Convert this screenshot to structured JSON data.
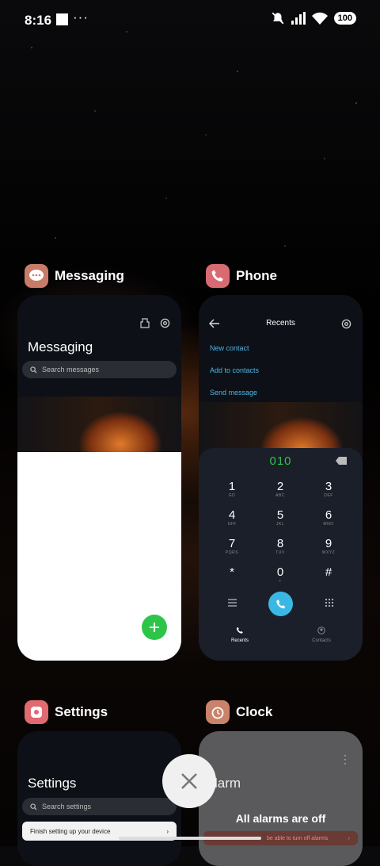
{
  "status": {
    "time": "8:16",
    "battery": "100"
  },
  "apps": {
    "messaging": {
      "name": "Messaging",
      "title": "Messaging",
      "search_placeholder": "Search messages"
    },
    "phone": {
      "name": "Phone",
      "header": "Recents",
      "links": [
        "New contact",
        "Add to contacts",
        "Send message"
      ],
      "dialed": "010",
      "keys": [
        {
          "d": "1",
          "l": "GD"
        },
        {
          "d": "2",
          "l": "ABC"
        },
        {
          "d": "3",
          "l": "DEF"
        },
        {
          "d": "4",
          "l": "GHI"
        },
        {
          "d": "5",
          "l": "JKL"
        },
        {
          "d": "6",
          "l": "MNO"
        },
        {
          "d": "7",
          "l": "PQRS"
        },
        {
          "d": "8",
          "l": "TUV"
        },
        {
          "d": "9",
          "l": "WXYZ"
        },
        {
          "d": "*",
          "l": ""
        },
        {
          "d": "0",
          "l": "+"
        },
        {
          "d": "#",
          "l": ""
        }
      ],
      "tabs": {
        "recents": "Recents",
        "contacts": "Contacts"
      }
    },
    "settings": {
      "name": "Settings",
      "title": "Settings",
      "search_placeholder": "Search settings",
      "banner": "Finish setting up your device"
    },
    "clock": {
      "name": "Clock",
      "title_partial": "larm",
      "empty": "All alarms are off",
      "notice": "be able to turn off alarms"
    }
  },
  "colors": {
    "accent": "#4cb8ea",
    "fab": "#2ec44a",
    "dialed": "#2ec44a"
  }
}
